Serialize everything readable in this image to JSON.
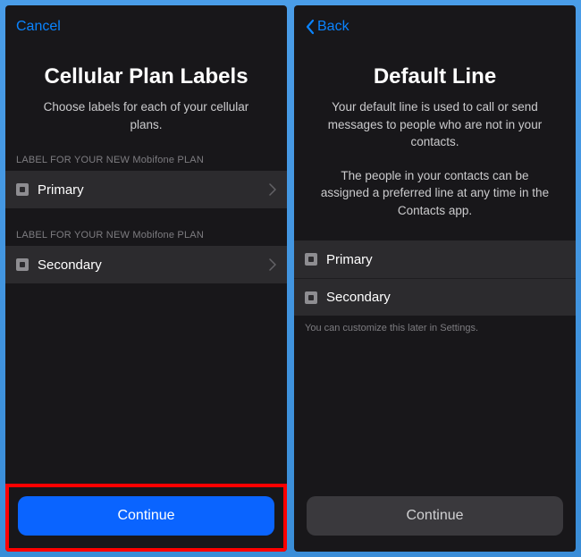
{
  "left": {
    "cancel": "Cancel",
    "title": "Cellular Plan Labels",
    "subtitle": "Choose labels for each of your cellular plans.",
    "sectionLabel1": "LABEL FOR YOUR NEW Mobifone PLAN",
    "option1": "Primary",
    "sectionLabel2": "LABEL FOR YOUR NEW Mobifone PLAN",
    "option2": "Secondary",
    "continue": "Continue"
  },
  "right": {
    "back": "Back",
    "title": "Default Line",
    "subtitle1": "Your default line is used to call or send messages to people who are not in your contacts.",
    "subtitle2": "The people in your contacts can be assigned a preferred line at any time in the Contacts app.",
    "options": {
      "primary": "Primary",
      "secondary": "Secondary"
    },
    "footerHint": "You can customize this later in Settings.",
    "continue": "Continue"
  }
}
